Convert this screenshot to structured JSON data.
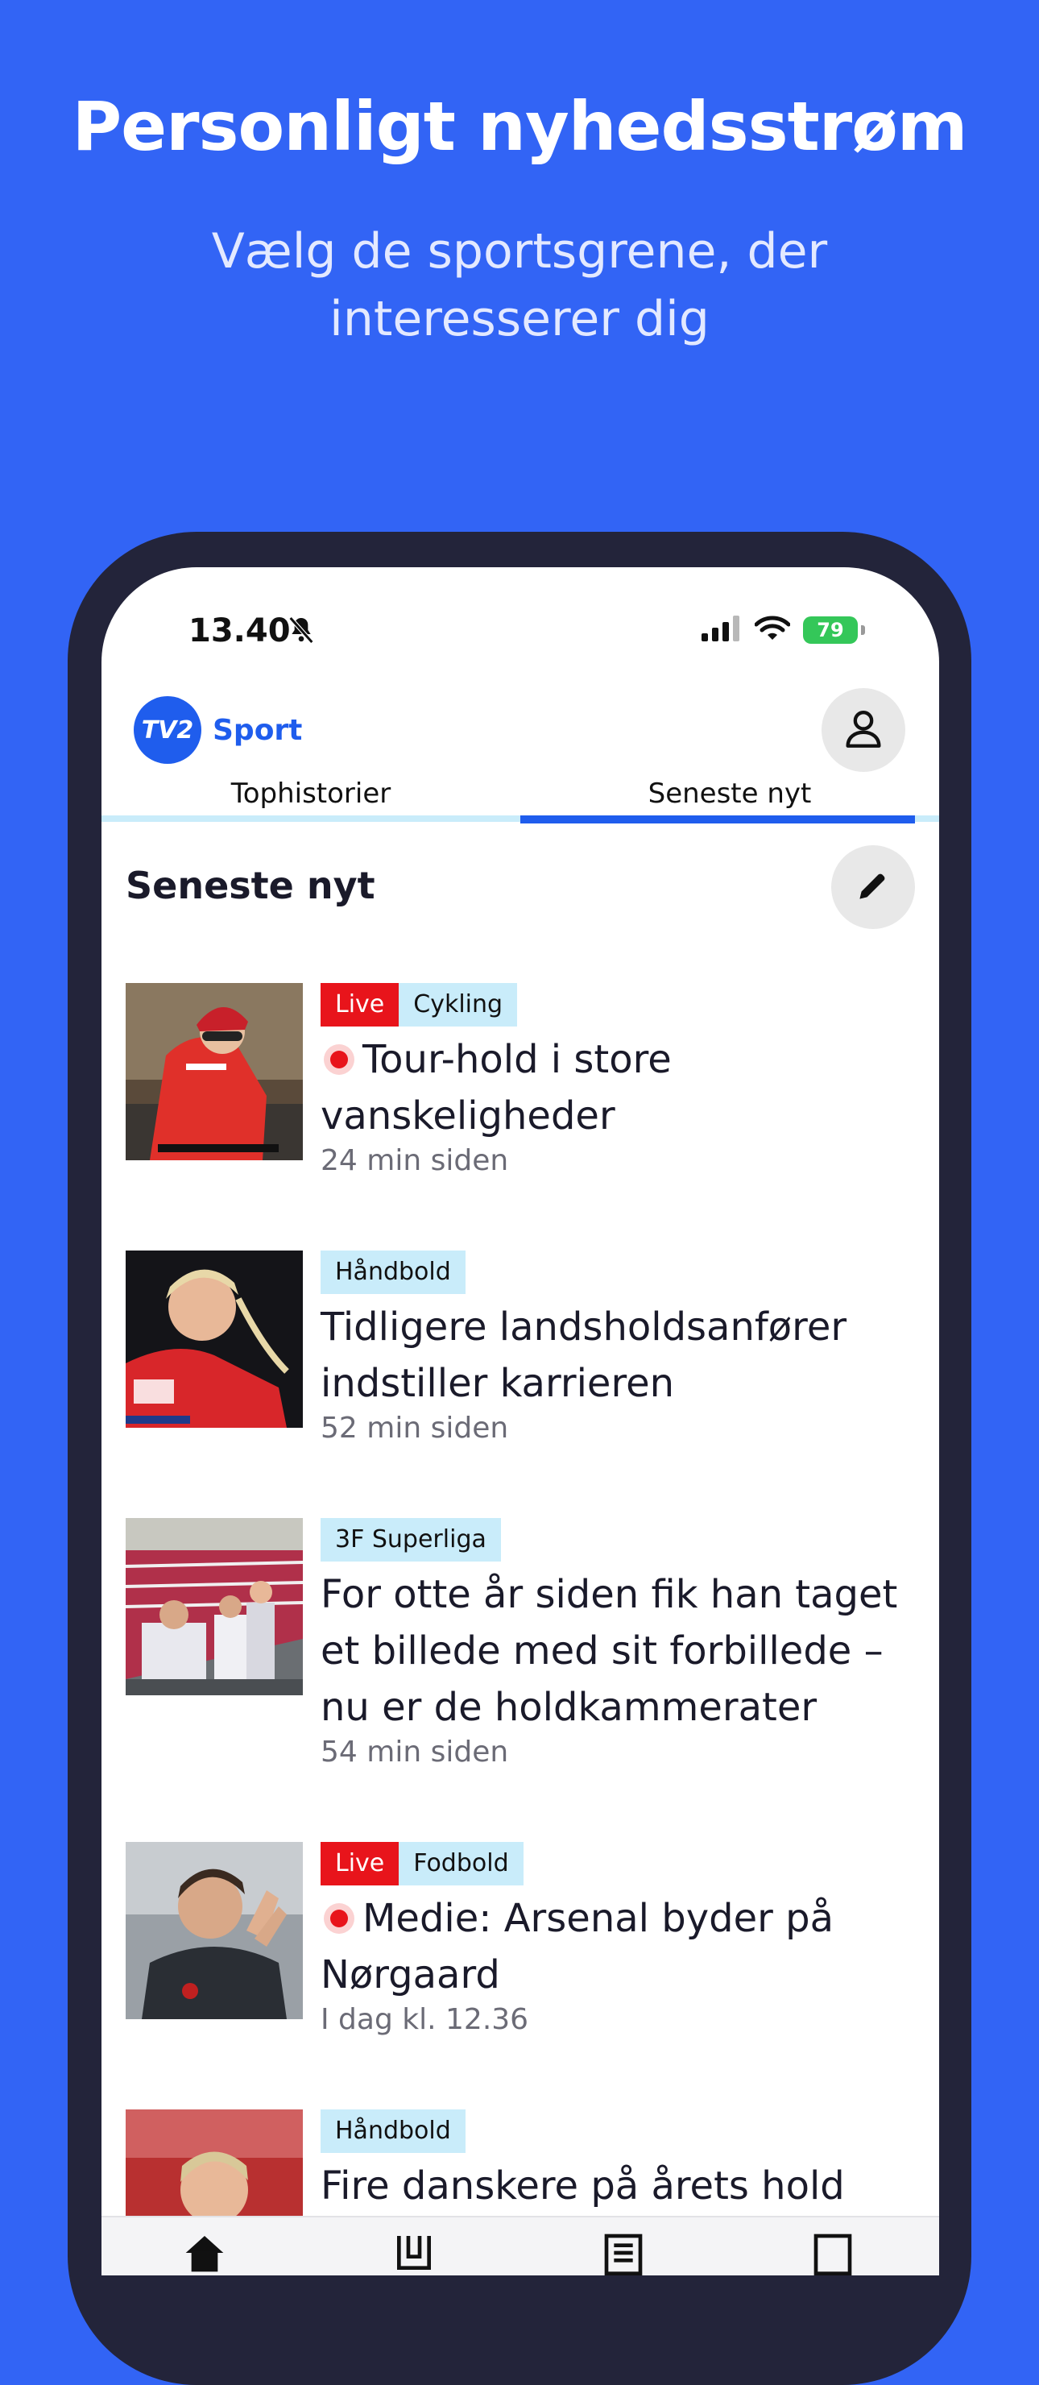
{
  "promo": {
    "title": "Personligt nyhedsstrøm",
    "subtitle": "Vælg de sportsgrene, der interesserer dig"
  },
  "status_bar": {
    "time": "13.40",
    "battery": "79"
  },
  "header": {
    "logo_text": "Sport",
    "logo_mark": "TV2"
  },
  "tabs": [
    {
      "label": "Tophistorier",
      "active": false
    },
    {
      "label": "Seneste nyt",
      "active": true
    }
  ],
  "section": {
    "title": "Seneste nyt"
  },
  "articles": [
    {
      "live": "Live",
      "category": "Cykling",
      "title": "Tour-hold i store vanskeligheder",
      "time": "24 min siden"
    },
    {
      "live": "",
      "category": "Håndbold",
      "title": "Tidligere landsholdsanfører indstiller karrieren",
      "time": "52 min siden"
    },
    {
      "live": "",
      "category": "3F Superliga",
      "title": "For otte år siden fik han taget et billede med sit forbillede – nu er de holdkammerater",
      "time": "54 min siden"
    },
    {
      "live": "Live",
      "category": "Fodbold",
      "title": "Medie: Arsenal byder på Nørgaard",
      "time": "I dag kl. 12.36"
    },
    {
      "live": "",
      "category": "Håndbold",
      "title": "Fire danskere på årets hold",
      "time": ""
    }
  ],
  "colors": {
    "background": "#3264f5",
    "accent": "#1f5ded",
    "live": "#e8141b",
    "category_tag": "#c9ecfa"
  }
}
